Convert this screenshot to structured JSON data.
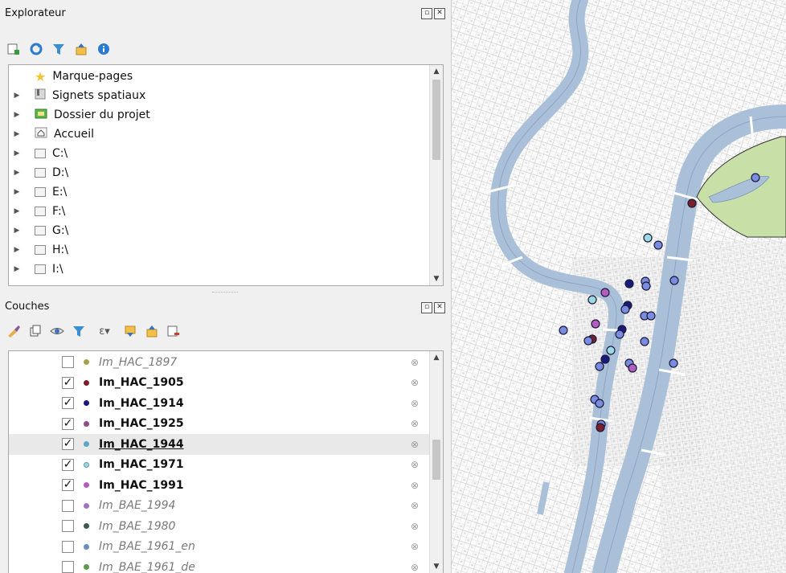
{
  "explorer": {
    "title": "Explorateur",
    "items": [
      {
        "label": "Marque-pages",
        "icon": "star-icon"
      },
      {
        "label": "Signets spatiaux",
        "icon": "bookmark-icon"
      },
      {
        "label": "Dossier du projet",
        "icon": "project-folder-icon"
      },
      {
        "label": "Accueil",
        "icon": "home-icon"
      },
      {
        "label": "C:\\",
        "icon": "folder-icon"
      },
      {
        "label": "D:\\",
        "icon": "folder-icon"
      },
      {
        "label": "E:\\",
        "icon": "folder-icon"
      },
      {
        "label": "F:\\",
        "icon": "folder-icon"
      },
      {
        "label": "G:\\",
        "icon": "folder-icon"
      },
      {
        "label": "H:\\",
        "icon": "folder-icon"
      },
      {
        "label": "I:\\",
        "icon": "folder-icon"
      }
    ]
  },
  "layers": {
    "title": "Couches",
    "items": [
      {
        "label": "Im_HAC_1897",
        "checked": false,
        "color": "#a7a24a"
      },
      {
        "label": "Im_HAC_1905",
        "checked": true,
        "color": "#7b1f2a"
      },
      {
        "label": "Im_HAC_1914",
        "checked": true,
        "color": "#1a1a7a"
      },
      {
        "label": "Im_HAC_1925",
        "checked": true,
        "color": "#8e4a8a"
      },
      {
        "label": "Im_HAC_1944",
        "checked": true,
        "color": "#5aa6c8",
        "selected": true
      },
      {
        "label": "Im_HAC_1971",
        "checked": true,
        "color": "#9ed8e2"
      },
      {
        "label": "Im_HAC_1991",
        "checked": true,
        "color": "#b45cc0"
      },
      {
        "label": "Im_BAE_1994",
        "checked": false,
        "color": "#a074c0"
      },
      {
        "label": "Im_BAE_1980",
        "checked": false,
        "color": "#3a5a4a"
      },
      {
        "label": "Im_BAE_1961_en",
        "checked": false,
        "color": "#6a8cc0"
      },
      {
        "label": "Im_BAE_1961_de",
        "checked": false,
        "color": "#5a9a4a"
      }
    ]
  },
  "colors": {
    "river": "#a9c0d8",
    "park": "#c8e0a8",
    "point_fill": "#7a8ce0"
  }
}
